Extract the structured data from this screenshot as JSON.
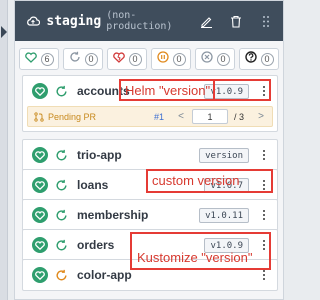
{
  "header": {
    "title": "staging",
    "subtitle": "(non-production)"
  },
  "filters": [
    {
      "icon": "heart-icon",
      "count": "6"
    },
    {
      "icon": "sync-icon",
      "count": "0"
    },
    {
      "icon": "broken-heart-icon",
      "count": "0"
    },
    {
      "icon": "pause-icon",
      "count": "0"
    },
    {
      "icon": "x-circle-icon",
      "count": "0"
    },
    {
      "icon": "question-icon",
      "count": "0"
    }
  ],
  "apps": [
    {
      "name": "accounts",
      "version": "v1.0.9"
    },
    {
      "name": "trio-app",
      "version": "version"
    },
    {
      "name": "loans",
      "version": "v1.0.7"
    },
    {
      "name": "membership",
      "version": "v1.0.11"
    },
    {
      "name": "orders",
      "version": "v1.0.9"
    },
    {
      "name": "color-app",
      "version": ""
    }
  ],
  "pending": {
    "label": "Pending PR",
    "number": "#1",
    "page": "1",
    "total": "/ 3"
  },
  "annotations": {
    "helm": "Helm \"version\"",
    "custom": "custom version",
    "kustomize": "Kustomize \"version\""
  },
  "colors": {
    "header": "#3f4d5c",
    "healthy": "#2f9e6e",
    "annotation": "#e53b35",
    "pending_bg": "#fbf1df"
  }
}
